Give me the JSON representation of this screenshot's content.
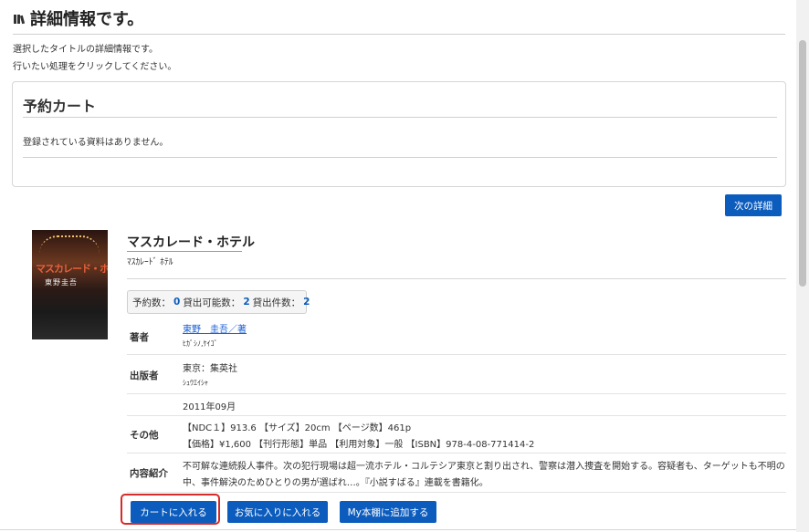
{
  "page": {
    "title": "詳細情報です。",
    "intro_line1": "選択したタイトルの詳細情報です。",
    "intro_line2": "行いたい処理をクリックしてください。"
  },
  "cart": {
    "title": "予約カート",
    "empty_message": "登録されている資料はありません。"
  },
  "next_button": "次の詳細",
  "book": {
    "cover_title": "マスカレード・ホテル",
    "cover_author": "東野圭吾",
    "title": "マスカレード・ホテル",
    "title_kana": "ﾏｽｶﾚｰﾄﾞ ﾎﾃﾙ",
    "counts": {
      "reserve_label": "予約数：",
      "reserve_value": "0",
      "available_label": "貸出可能数：",
      "available_value": "2",
      "loans_label": "貸出件数：",
      "loans_value": "2"
    },
    "details": {
      "author_label": "著者",
      "author_value": "東野　圭吾／著",
      "author_kana": "ﾋｶﾞｼﾉ,ｹｲｺﾞ",
      "publisher_label": "出版者",
      "publisher_value": "東京：集英社",
      "publisher_kana": "ｼｭｳｴｲｼｬ",
      "date_value": "2011年09月",
      "other_label": "その他",
      "other_line1": "【NDC１】913.6 【サイズ】20cm 【ページ数】461p",
      "other_line2": "【価格】¥1,600 【刊行形態】単品 【利用対象】一般 【ISBN】978-4-08-771414-2",
      "summary_label": "内容紹介",
      "summary_line1": "不可解な連続殺人事件。次の犯行現場は超一流ホテル・コルテシア東京と割り出され、警察は潜入捜査を開始する。容疑者も、ターゲットも不明の",
      "summary_line2": "中、事件解決のためひとりの男が選ばれ…。『小説すばる』連載を書籍化。"
    }
  },
  "actions": {
    "add_to_cart": "カートに入れる",
    "add_to_favorites": "お気に入りに入れる",
    "add_to_shelf": "My本棚に追加する"
  },
  "colors": {
    "primary_button": "#0c5cbd",
    "link": "#1a5fd6",
    "highlight": "#d62a2a"
  }
}
